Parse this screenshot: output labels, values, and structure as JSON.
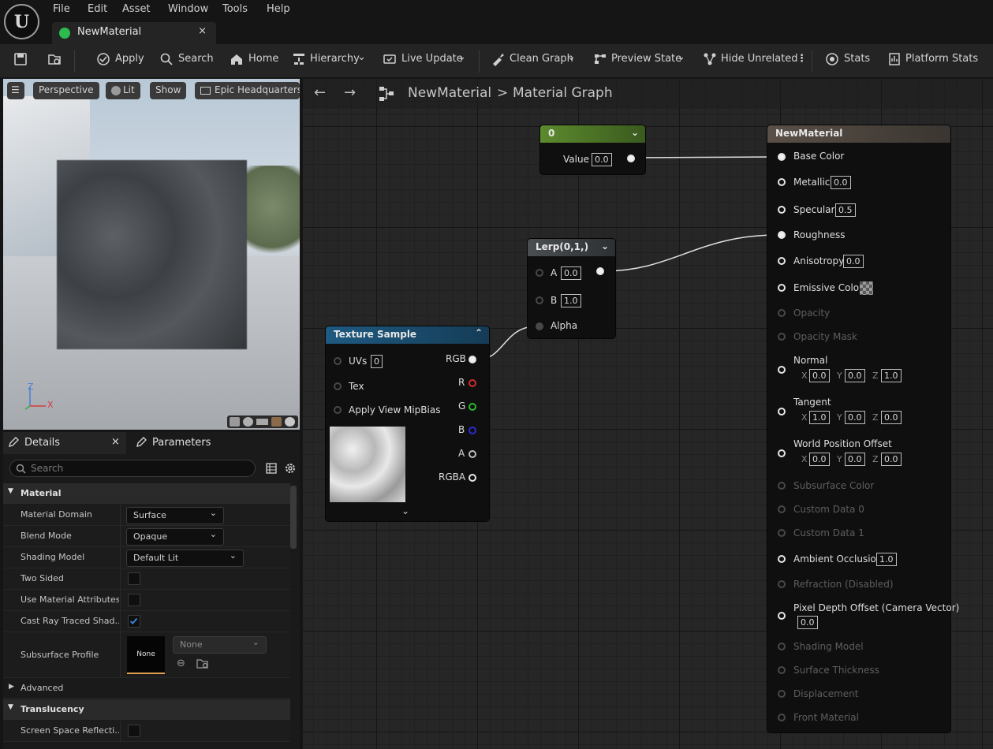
{
  "menu": {
    "file": "File",
    "edit": "Edit",
    "asset": "Asset",
    "window": "Window",
    "tools": "Tools",
    "help": "Help"
  },
  "tab": {
    "title": "NewMaterial",
    "close": "×"
  },
  "toolbar": {
    "apply": "Apply",
    "search": "Search",
    "home": "Home",
    "hierarchy": "Hierarchy",
    "live_update": "Live Update",
    "clean_graph": "Clean Graph",
    "preview_state": "Preview State",
    "hide_unrelated": "Hide Unrelated",
    "stats": "Stats",
    "platform_stats": "Platform Stats"
  },
  "viewport": {
    "perspective": "Perspective",
    "lit": "Lit",
    "show": "Show",
    "environment": "Epic Headquarters",
    "axis_z": "Z",
    "axis_x": "X"
  },
  "details": {
    "tab_details": "Details",
    "tab_close": "×",
    "tab_parameters": "Parameters",
    "search_placeholder": "Search",
    "cat_material": "Material",
    "material_domain": {
      "label": "Material Domain",
      "value": "Surface"
    },
    "blend_mode": {
      "label": "Blend Mode",
      "value": "Opaque"
    },
    "shading_model": {
      "label": "Shading Model",
      "value": "Default Lit"
    },
    "two_sided": {
      "label": "Two Sided",
      "checked": false
    },
    "use_material_attributes": {
      "label": "Use Material Attributes",
      "checked": false
    },
    "cast_ray_traced_shadows": {
      "label": "Cast Ray Traced Shad...",
      "checked": true
    },
    "subsurface_profile": {
      "label": "Subsurface Profile",
      "thumb": "None",
      "value": "None"
    },
    "cat_advanced": "Advanced",
    "cat_translucency": "Translucency",
    "screen_space_reflections": {
      "label": "Screen Space Reflecti...",
      "checked": false
    }
  },
  "graph": {
    "breadcrumb_root": "NewMaterial",
    "breadcrumb_sep": ">",
    "breadcrumb_leaf": "Material Graph",
    "const_node": {
      "title": "0",
      "value_label": "Value",
      "value": "0.0",
      "color": "#5d8a2e"
    },
    "lerp_node": {
      "title": "Lerp(0,1,)",
      "a_label": "A",
      "a_value": "0.0",
      "b_label": "B",
      "b_value": "1.0",
      "alpha_label": "Alpha"
    },
    "texture_node": {
      "title": "Texture Sample",
      "uvs_label": "UVs",
      "uvs_value": "0",
      "tex_label": "Tex",
      "mipbias_label": "Apply View MipBias",
      "rgb": "RGB",
      "r": "R",
      "g": "G",
      "b": "B",
      "a": "A",
      "rgba": "RGBA",
      "color": "#1e5a82"
    },
    "result_node": {
      "title": "NewMaterial",
      "base_color": "Base Color",
      "metallic": "Metallic",
      "metallic_value": "0.0",
      "specular": "Specular",
      "specular_value": "0.5",
      "roughness": "Roughness",
      "anisotropy": "Anisotropy",
      "anisotropy_value": "0.0",
      "emissive_color": "Emissive Color",
      "opacity": "Opacity",
      "opacity_mask": "Opacity Mask",
      "normal": "Normal",
      "normal_x": "0.0",
      "normal_y": "0.0",
      "normal_z": "1.0",
      "tangent": "Tangent",
      "tangent_x": "1.0",
      "tangent_y": "0.0",
      "tangent_z": "0.0",
      "world_position_offset": "World Position Offset",
      "wpo_x": "0.0",
      "wpo_y": "0.0",
      "wpo_z": "0.0",
      "subsurface_color": "Subsurface Color",
      "custom_data_0": "Custom Data 0",
      "custom_data_1": "Custom Data 1",
      "ambient_occlusion": "Ambient Occlusion",
      "ambient_occlusion_value": "1.0",
      "refraction": "Refraction (Disabled)",
      "pixel_depth_offset": "Pixel Depth Offset (Camera Vector)",
      "pixel_depth_offset_value": "0.0",
      "shading_model": "Shading Model",
      "surface_thickness": "Surface Thickness",
      "displacement": "Displacement",
      "front_material": "Front Material",
      "x": "X",
      "y": "Y",
      "z": "Z"
    }
  }
}
